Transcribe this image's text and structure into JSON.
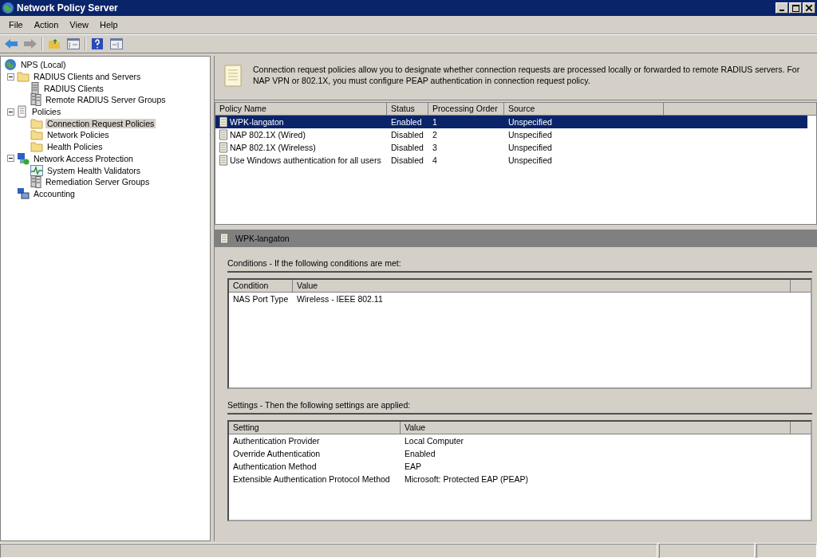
{
  "window": {
    "title": "Network Policy Server"
  },
  "menu": [
    "File",
    "Action",
    "View",
    "Help"
  ],
  "tree": [
    {
      "label": "NPS (Local)",
      "kind": "globe",
      "selected": false,
      "children": [
        {
          "label": "RADIUS Clients and Servers",
          "kind": "folder",
          "selected": false,
          "expanded": true,
          "children": [
            {
              "label": "RADIUS Clients",
              "kind": "server",
              "selected": false
            },
            {
              "label": "Remote RADIUS Server Groups",
              "kind": "servers",
              "selected": false
            }
          ]
        },
        {
          "label": "Policies",
          "kind": "policy",
          "selected": false,
          "expanded": true,
          "children": [
            {
              "label": "Connection Request Policies",
              "kind": "folder",
              "selected": true
            },
            {
              "label": "Network Policies",
              "kind": "folder",
              "selected": false
            },
            {
              "label": "Health Policies",
              "kind": "folder",
              "selected": false
            }
          ]
        },
        {
          "label": "Network Access Protection",
          "kind": "nap",
          "selected": false,
          "expanded": true,
          "children": [
            {
              "label": "System Health Validators",
              "kind": "health",
              "selected": false
            },
            {
              "label": "Remediation Server Groups",
              "kind": "servers",
              "selected": false
            }
          ]
        },
        {
          "label": "Accounting",
          "kind": "accounting",
          "selected": false
        }
      ]
    }
  ],
  "description": "Connection request policies allow you to designate whether connection requests are processed locally or forwarded to remote RADIUS servers. For NAP VPN or 802.1X, you must configure PEAP authentication in connection request policy.",
  "policies": {
    "columns": [
      "Policy Name",
      "Status",
      "Processing Order",
      "Source"
    ],
    "rows": [
      {
        "cells": [
          "WPK-langaton",
          "Enabled",
          "1",
          "Unspecified"
        ],
        "selected": true
      },
      {
        "cells": [
          "NAP 802.1X (Wired)",
          "Disabled",
          "2",
          "Unspecified"
        ],
        "selected": false
      },
      {
        "cells": [
          "NAP 802.1X (Wireless)",
          "Disabled",
          "3",
          "Unspecified"
        ],
        "selected": false
      },
      {
        "cells": [
          "Use Windows authentication for all users",
          "Disabled",
          "4",
          "Unspecified"
        ],
        "selected": false
      }
    ]
  },
  "detail": {
    "title": "WPK-langaton",
    "conditions": {
      "heading": "Conditions - If the following conditions are met:",
      "columns": [
        "Condition",
        "Value"
      ],
      "rows": [
        [
          "NAS Port Type",
          "Wireless - IEEE 802.11"
        ]
      ]
    },
    "settings": {
      "heading": "Settings - Then the following settings are applied:",
      "columns": [
        "Setting",
        "Value"
      ],
      "rows": [
        [
          "Authentication Provider",
          "Local Computer"
        ],
        [
          "Override Authentication",
          "Enabled"
        ],
        [
          "Authentication Method",
          "EAP"
        ],
        [
          "Extensible Authentication Protocol Method",
          "Microsoft: Protected EAP (PEAP)"
        ]
      ]
    }
  }
}
